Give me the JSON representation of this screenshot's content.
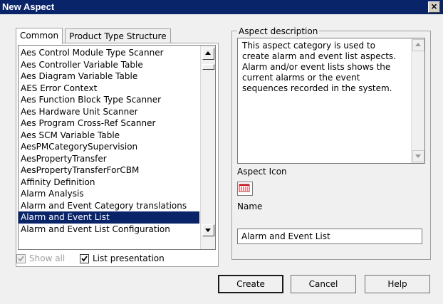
{
  "window": {
    "title": "New Aspect"
  },
  "tabs": [
    {
      "label": "Common",
      "active": true
    },
    {
      "label": "Product Type Structure",
      "active": false
    }
  ],
  "aspect_list": {
    "items": [
      "Aes Control Module Type Scanner",
      "Aes Controller Variable Table",
      "Aes Diagram Variable Table",
      "AES Error Context",
      "Aes Function Block Type Scanner",
      "Aes Hardware Unit Scanner",
      "Aes Program Cross-Ref Scanner",
      "Aes SCM Variable Table",
      "AesPMCategorySupervision",
      "AesPropertyTransfer",
      "AesPropertyTransferForCBM",
      "Affinity Definition",
      "Alarm Analysis",
      "Alarm and Event Category translations",
      "Alarm and Event List",
      "Alarm and Event List Configuration"
    ],
    "selected": "Alarm and Event List"
  },
  "aspect_description": {
    "label": "Aspect description",
    "text": "This aspect category is used to create alarm and event list aspects. Alarm and/or event lists shows the current alarms or the event sequences recorded in the system."
  },
  "aspect_icon": {
    "label": "Aspect Icon",
    "icon": "alarm-list-icon"
  },
  "name": {
    "label": "Name",
    "value": "Alarm and Event List"
  },
  "options": {
    "show_all": {
      "label": "Show all",
      "checked": true,
      "disabled": true
    },
    "list_presentation": {
      "label": "List presentation",
      "checked": true
    }
  },
  "buttons": {
    "create": "Create",
    "cancel": "Cancel",
    "help": "Help"
  },
  "colors": {
    "title_bar": "#0a246a",
    "selection": "#0a246a",
    "icon_red": "#c0141e"
  }
}
